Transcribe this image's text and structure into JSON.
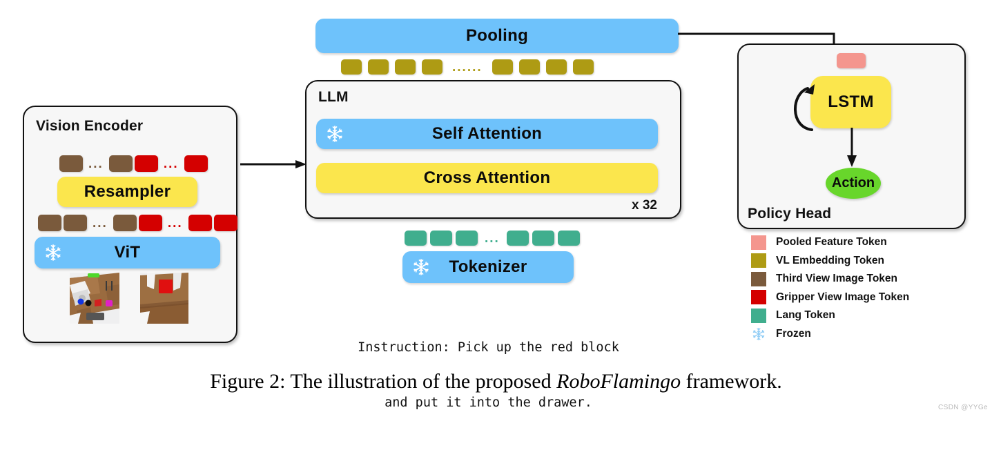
{
  "figure": {
    "caption_prefix": "Figure 2: The illustration of the proposed ",
    "caption_italic": "RoboFlamingo",
    "caption_suffix": " framework.",
    "watermark": "CSDN @YYGe"
  },
  "colors": {
    "blue": "#6EC2FB",
    "yellow": "#FBE64D",
    "olive": "#AE9B14",
    "brown": "#7A5A3C",
    "red": "#D40000",
    "teal": "#40AE8E",
    "pink": "#F4968E",
    "green": "#68D62B",
    "box_fill": "#F7F7F7",
    "stroke": "#111111"
  },
  "vision_encoder": {
    "title": "Vision Encoder",
    "resampler_label": "Resampler",
    "vit_label": "ViT",
    "vit_frozen_icon": "snowflake-icon",
    "top_token_row": [
      {
        "type": "token",
        "color": "#7A5A3C"
      },
      {
        "type": "dots",
        "color": "#7A5A3C",
        "text": "..."
      },
      {
        "type": "token",
        "color": "#7A5A3C"
      },
      {
        "type": "token",
        "color": "#D40000"
      },
      {
        "type": "dots",
        "color": "#D40000",
        "text": "..."
      },
      {
        "type": "token",
        "color": "#D40000"
      }
    ],
    "bottom_token_row": [
      {
        "type": "token",
        "color": "#7A5A3C"
      },
      {
        "type": "token",
        "color": "#7A5A3C"
      },
      {
        "type": "dots",
        "color": "#7A5A3C",
        "text": "..."
      },
      {
        "type": "token",
        "color": "#7A5A3C"
      },
      {
        "type": "token",
        "color": "#D40000"
      },
      {
        "type": "dots",
        "color": "#D40000",
        "text": "..."
      },
      {
        "type": "token",
        "color": "#D40000"
      },
      {
        "type": "token",
        "color": "#D40000"
      }
    ],
    "thumbnails": [
      "third-view-scene-image",
      "gripper-view-scene-image"
    ]
  },
  "llm": {
    "title": "LLM",
    "self_attention_label": "Self Attention",
    "self_attention_frozen_icon": "snowflake-icon",
    "cross_attention_label": "Cross Attention",
    "repeat_label": "x 32"
  },
  "pooling": {
    "label": "Pooling"
  },
  "vl_token_row": [
    {
      "type": "token",
      "color": "#AE9B14"
    },
    {
      "type": "token",
      "color": "#AE9B14"
    },
    {
      "type": "token",
      "color": "#AE9B14"
    },
    {
      "type": "token",
      "color": "#AE9B14"
    },
    {
      "type": "dots",
      "color": "#AE9B14",
      "text": "......"
    },
    {
      "type": "token",
      "color": "#AE9B14"
    },
    {
      "type": "token",
      "color": "#AE9B14"
    },
    {
      "type": "token",
      "color": "#AE9B14"
    },
    {
      "type": "token",
      "color": "#AE9B14"
    }
  ],
  "tokenizer": {
    "label": "Tokenizer",
    "frozen_icon": "snowflake-icon",
    "lang_token_row": [
      {
        "type": "token",
        "color": "#40AE8E"
      },
      {
        "type": "token",
        "color": "#40AE8E"
      },
      {
        "type": "token",
        "color": "#40AE8E"
      },
      {
        "type": "dots",
        "color": "#40AE8E",
        "text": "..."
      },
      {
        "type": "token",
        "color": "#40AE8E"
      },
      {
        "type": "token",
        "color": "#40AE8E"
      },
      {
        "type": "token",
        "color": "#40AE8E"
      }
    ],
    "instruction_line1": "Instruction: Pick up the red block",
    "instruction_line2": "and put it into the drawer."
  },
  "policy_head": {
    "title": "Policy Head",
    "pooled_token_color": "#F4968E",
    "lstm_label": "LSTM",
    "action_label": "Action"
  },
  "legend": {
    "items": [
      {
        "label": "Pooled Feature Token",
        "color": "#F4968E",
        "icon": "color-swatch"
      },
      {
        "label": "VL Embedding Token",
        "color": "#AE9B14",
        "icon": "color-swatch"
      },
      {
        "label": "Third View Image Token",
        "color": "#7A5A3C",
        "icon": "color-swatch"
      },
      {
        "label": "Gripper View Image Token",
        "color": "#D40000",
        "icon": "color-swatch"
      },
      {
        "label": "Lang Token",
        "color": "#40AE8E",
        "icon": "color-swatch"
      },
      {
        "label": "Frozen",
        "color": "#8FCCF5",
        "icon": "snowflake-icon"
      }
    ]
  }
}
